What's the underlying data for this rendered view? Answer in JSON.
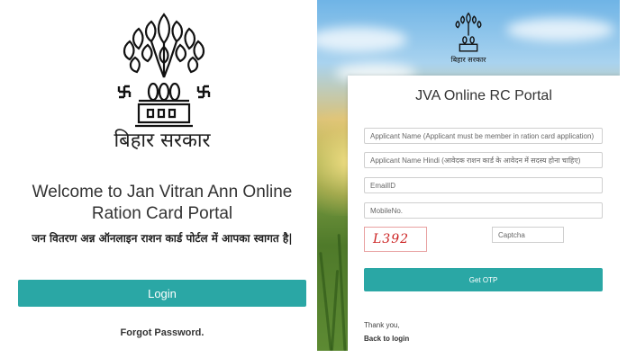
{
  "left": {
    "emblem_icon": "bihar-emblem-bodhi-leaf",
    "gov_name": "बिहार सरकार",
    "welcome_line1": "Welcome to Jan Vitran Ann Online",
    "welcome_line2": "Ration Card Portal",
    "welcome_hindi": "जन वितरण अन्न ऑनलाइन राशन कार्ड पोर्टल में आपका स्वागत है|",
    "login_label": "Login",
    "forgot_label": "Forgot Password.",
    "accent": "#2aa7a5"
  },
  "right": {
    "emblem_icon": "bihar-emblem-bodhi-leaf",
    "gov_name": "बिहार सरकार",
    "title": "JVA Online RC Portal",
    "fields": {
      "applicant_name_placeholder": "Applicant Name (Applicant must be member in ration card application)",
      "applicant_name_hindi_placeholder": "Applicant Name Hindi (आवेदक राशन कार्ड के आवेदन में सदस्य होना चाहिए)",
      "email_placeholder": "EmailID",
      "mobile_placeholder": "MobileNo."
    },
    "captcha_text": "L392",
    "captcha_placeholder": "Captcha",
    "otp_label": "Get OTP",
    "thanks": "Thank you,",
    "back_label": "Back to login",
    "accent": "#2aa7a5"
  }
}
